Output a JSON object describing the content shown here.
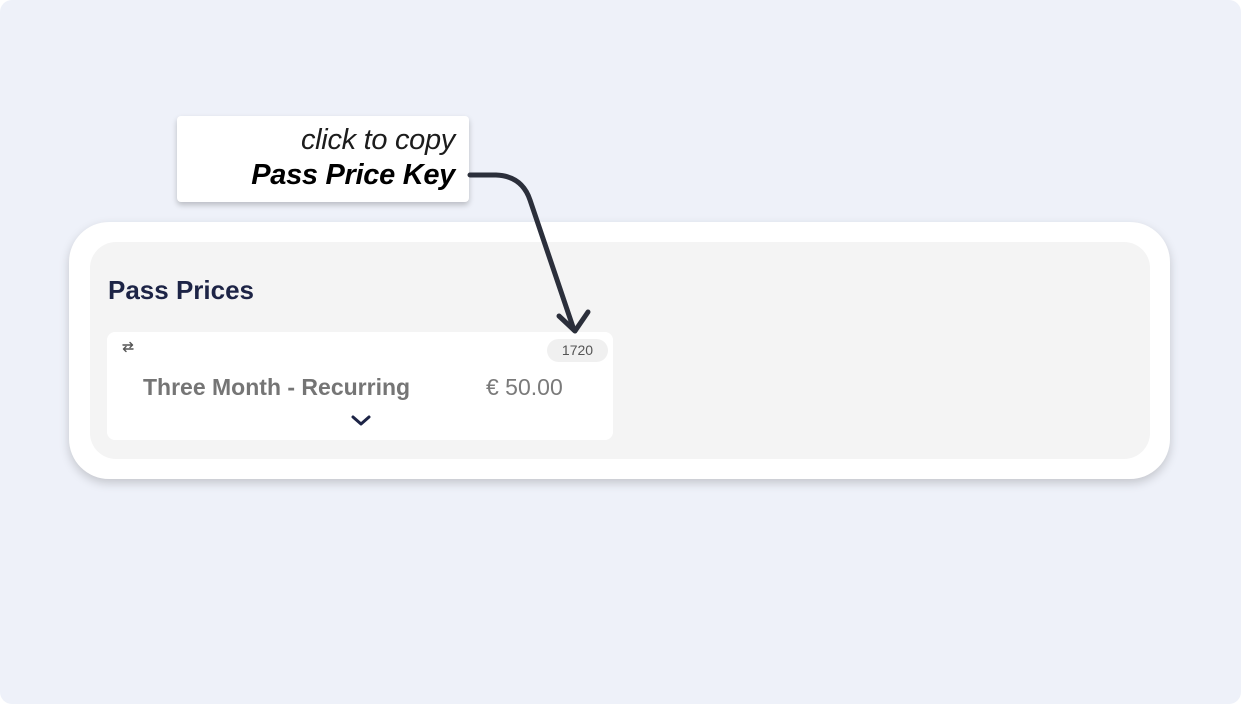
{
  "callout": {
    "line1": "click to copy",
    "line2": "Pass Price Key"
  },
  "section": {
    "title": "Pass Prices"
  },
  "price": {
    "name": "Three Month - Recurring",
    "amount": "€ 50.00",
    "key": "1720",
    "recurring_icon": "repeat-icon",
    "expand_icon": "chevron-down-icon"
  },
  "colors": {
    "background": "#eef1f9",
    "title": "#1d2446",
    "arrow": "#2b2f3b"
  }
}
